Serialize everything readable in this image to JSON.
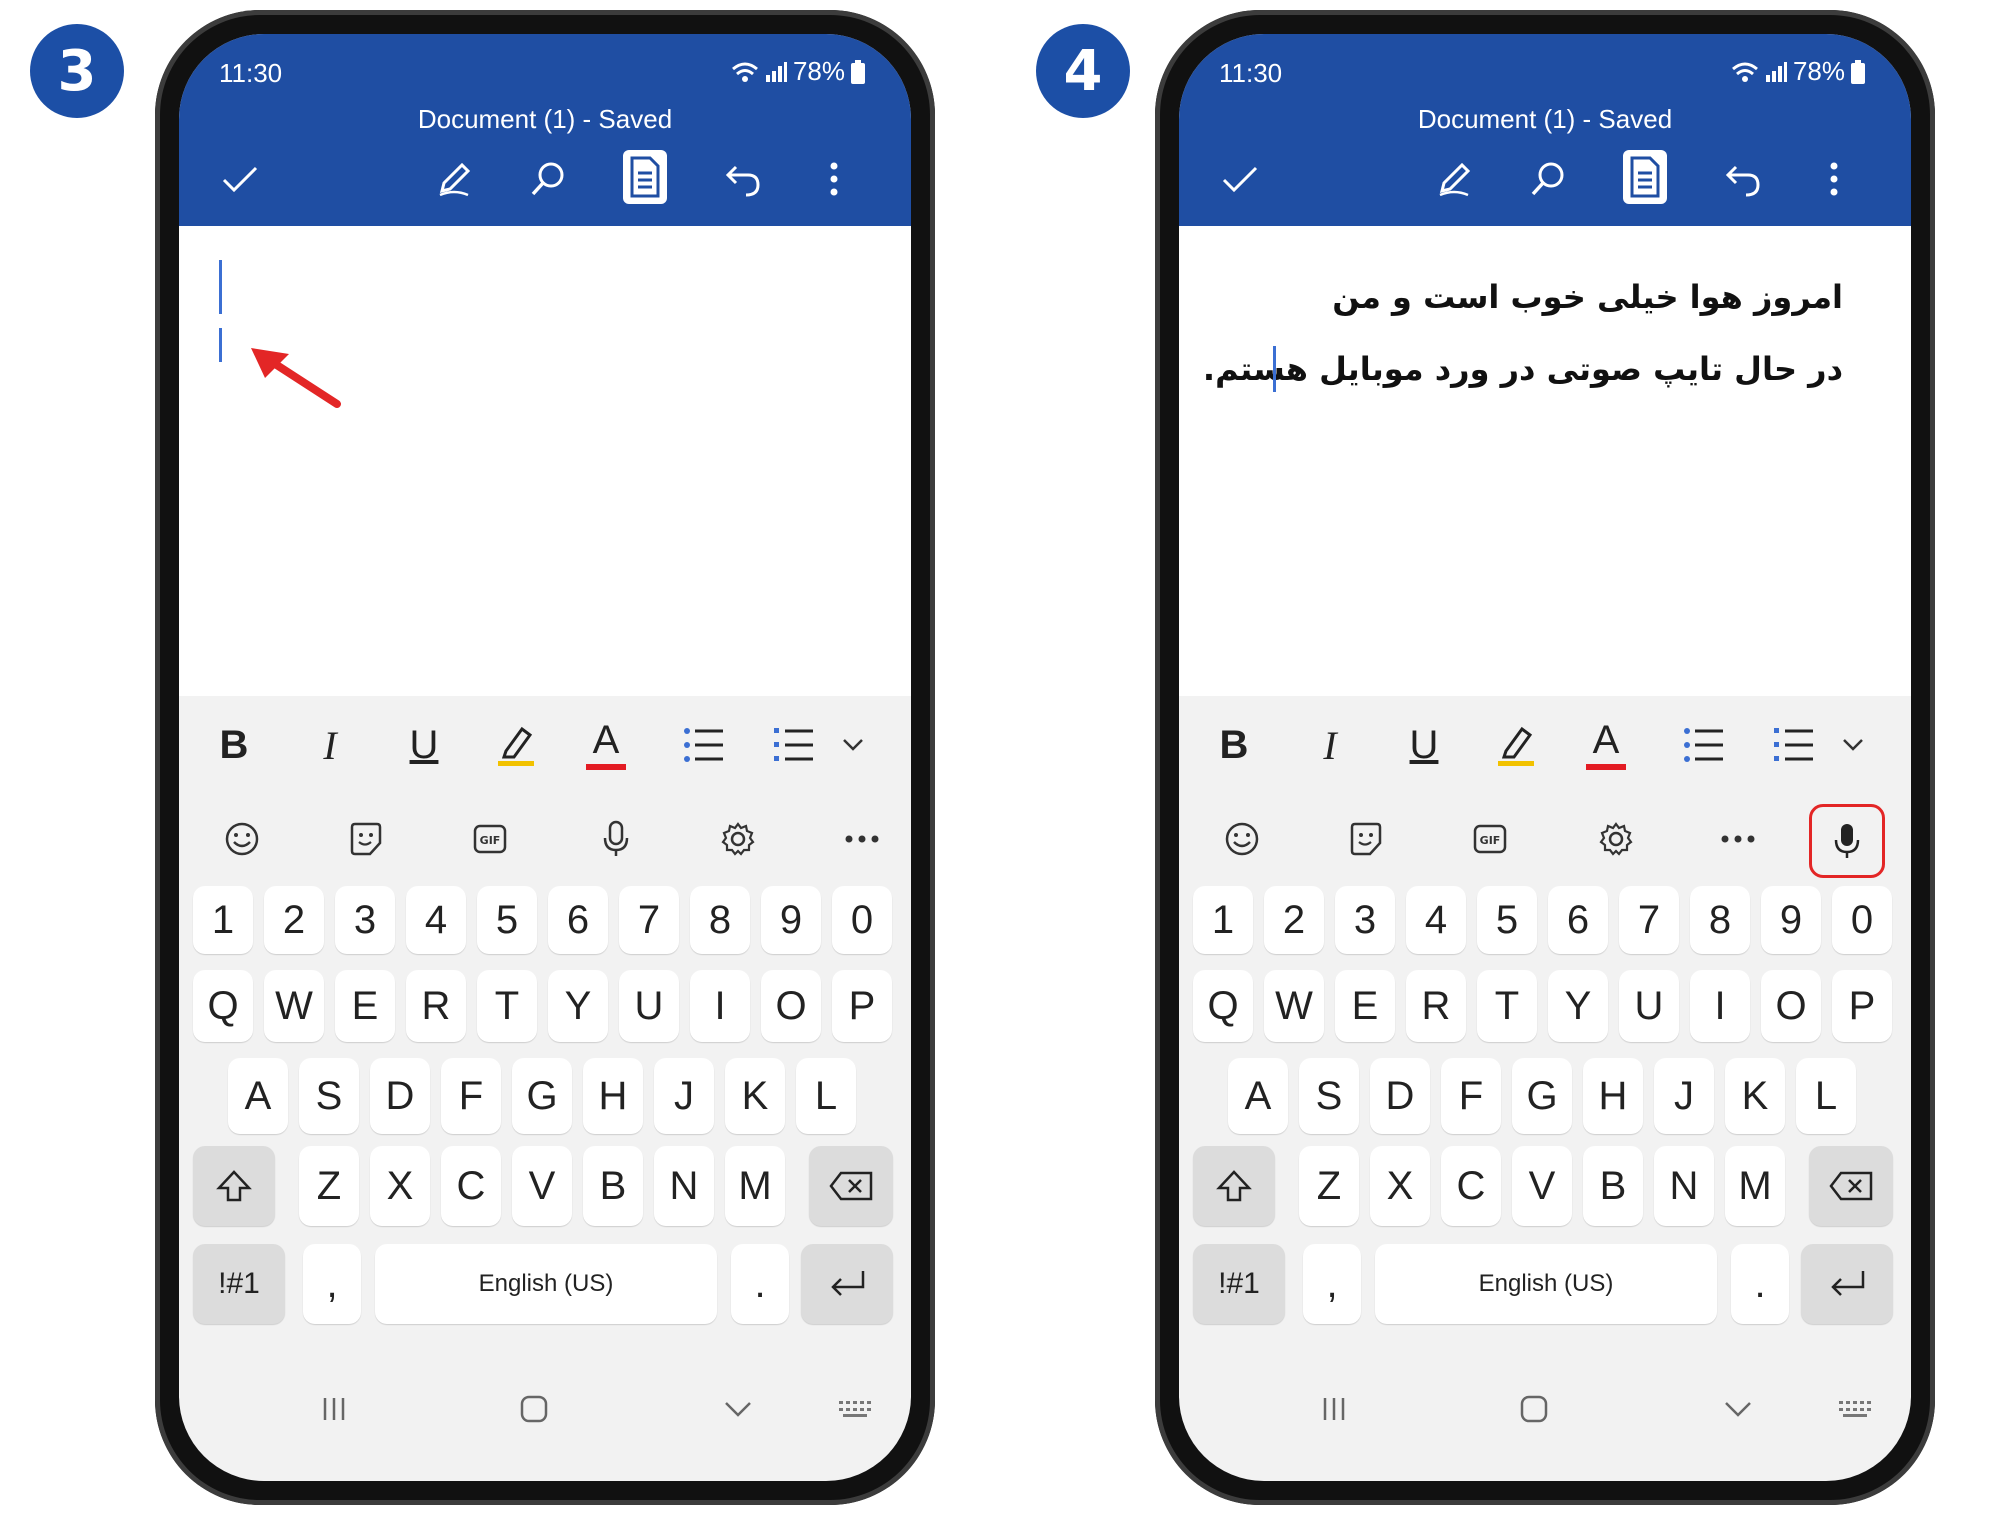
{
  "steps": [
    {
      "badge": "3",
      "status": {
        "time": "11:30",
        "battery": "78%"
      },
      "doc_title": "Document (1) - Saved",
      "body_lines": [],
      "keyboard": {
        "numbers": [
          "1",
          "2",
          "3",
          "4",
          "5",
          "6",
          "7",
          "8",
          "9",
          "0"
        ],
        "row1": [
          "Q",
          "W",
          "E",
          "R",
          "T",
          "Y",
          "U",
          "I",
          "O",
          "P"
        ],
        "row2": [
          "A",
          "S",
          "D",
          "F",
          "G",
          "H",
          "J",
          "K",
          "L"
        ],
        "row3": [
          "Z",
          "X",
          "C",
          "V",
          "B",
          "N",
          "M"
        ],
        "sym_label": "!#1",
        "comma": ",",
        "space_label": "English (US)",
        "period": "."
      },
      "format_bar": {
        "bold": "B",
        "italic": "I",
        "underline": "U",
        "font_color": "A"
      }
    },
    {
      "badge": "4",
      "status": {
        "time": "11:30",
        "battery": "78%"
      },
      "doc_title": "Document (1) - Saved",
      "body_lines": [
        "امروز هوا خیلی خوب است و من",
        "در حال تایپ صوتی در ورد موبایل هستم."
      ],
      "keyboard": {
        "numbers": [
          "1",
          "2",
          "3",
          "4",
          "5",
          "6",
          "7",
          "8",
          "9",
          "0"
        ],
        "row1": [
          "Q",
          "W",
          "E",
          "R",
          "T",
          "Y",
          "U",
          "I",
          "O",
          "P"
        ],
        "row2": [
          "A",
          "S",
          "D",
          "F",
          "G",
          "H",
          "J",
          "K",
          "L"
        ],
        "row3": [
          "Z",
          "X",
          "C",
          "V",
          "B",
          "N",
          "M"
        ],
        "sym_label": "!#1",
        "comma": ",",
        "space_label": "English (US)",
        "period": "."
      },
      "format_bar": {
        "bold": "B",
        "italic": "I",
        "underline": "U",
        "font_color": "A"
      }
    }
  ],
  "colors": {
    "appbar": "#1f4ea3",
    "badge": "#1c4fa6",
    "highlight_underline": "#f2c200",
    "font_color_underline": "#e31b23",
    "annotation_red": "#e32626"
  },
  "icons": {
    "toolbar": [
      "check-icon",
      "draw-pen-icon",
      "search-icon",
      "document-view-icon",
      "undo-icon",
      "more-vertical-icon"
    ],
    "keyboard_utility_step3": [
      "emoji-icon",
      "sticker-icon",
      "gif-icon",
      "microphone-icon",
      "settings-gear-icon",
      "more-horizontal-icon"
    ],
    "keyboard_utility_step4": [
      "emoji-icon",
      "sticker-icon",
      "gif-icon",
      "settings-gear-icon",
      "more-horizontal-icon",
      "microphone-icon"
    ]
  }
}
